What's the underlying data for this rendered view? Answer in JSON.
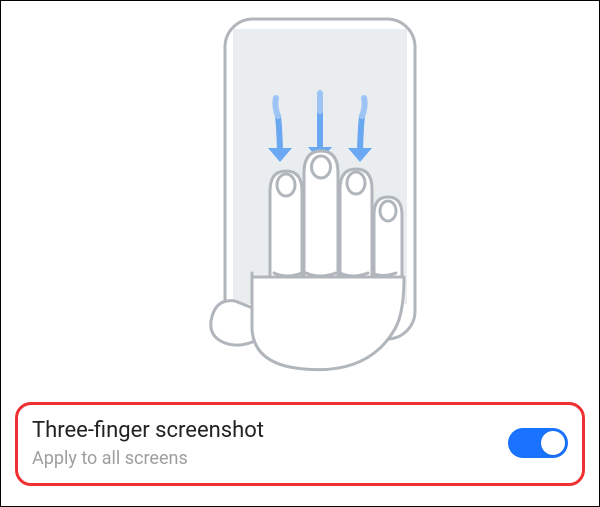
{
  "illustration": {
    "name": "three-finger-swipe-down-gesture"
  },
  "setting": {
    "title": "Three-finger screenshot",
    "subtitle": "Apply to all screens",
    "toggle_on": true,
    "toggle_accent": "#1a73ff"
  },
  "highlight": {
    "color": "#ef3030"
  }
}
